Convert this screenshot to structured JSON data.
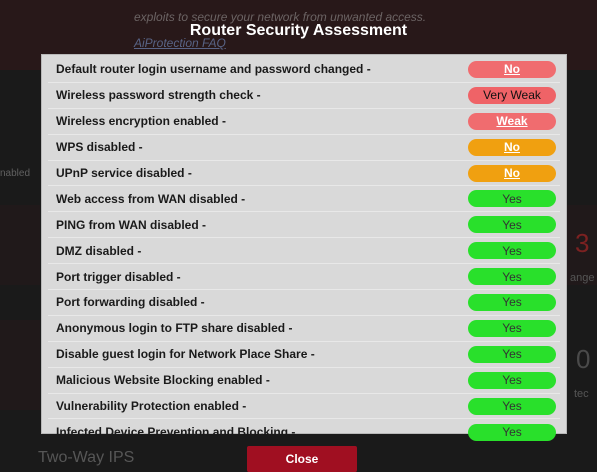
{
  "background": {
    "intro_text": "exploits to secure your network from unwanted access.",
    "faq_link": "AiProtection FAQ",
    "side_text": "nabled",
    "number_right_1": "3",
    "side_right_1": "ange",
    "number_right_2": "0",
    "side_right_2": "tec",
    "section_label": "Two-Way IPS"
  },
  "modal": {
    "title": "Router Security Assessment",
    "rows": [
      {
        "label": "Default router login username and password changed -",
        "status": "No"
      },
      {
        "label": "Wireless password strength check -",
        "status": "Very Weak"
      },
      {
        "label": "Wireless encryption enabled -",
        "status": "Weak"
      },
      {
        "label": "WPS disabled -",
        "status": "No"
      },
      {
        "label": "UPnP service disabled -",
        "status": "No"
      },
      {
        "label": "Web access from WAN disabled -",
        "status": "Yes"
      },
      {
        "label": "PING from WAN disabled -",
        "status": "Yes"
      },
      {
        "label": "DMZ disabled -",
        "status": "Yes"
      },
      {
        "label": "Port trigger disabled -",
        "status": "Yes"
      },
      {
        "label": "Port forwarding disabled -",
        "status": "Yes"
      },
      {
        "label": "Anonymous login to FTP share disabled -",
        "status": "Yes"
      },
      {
        "label": "Disable guest login for Network Place Share -",
        "status": "Yes"
      },
      {
        "label": "Malicious Website Blocking enabled -",
        "status": "Yes"
      },
      {
        "label": "Vulnerability Protection enabled -",
        "status": "Yes"
      },
      {
        "label": "Infected Device Prevention and Blocking -",
        "status": "Yes"
      }
    ],
    "close_label": "Close"
  },
  "colors": {
    "no_red": "#f06c6f",
    "warn_orange": "#f0a010",
    "yes_green": "#29e02b",
    "close_red": "#a00f21"
  }
}
